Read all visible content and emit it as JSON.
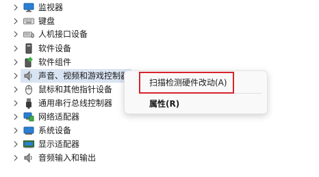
{
  "device_tree": {
    "items": [
      {
        "label": "监视器",
        "icon": "monitor-icon"
      },
      {
        "label": "键盘",
        "icon": "keyboard-icon"
      },
      {
        "label": "人机接口设备",
        "icon": "hid-icon"
      },
      {
        "label": "软件设备",
        "icon": "software-device-icon"
      },
      {
        "label": "软件组件",
        "icon": "software-component-icon"
      },
      {
        "label": "声音、视频和游戏控制器",
        "icon": "speaker-icon",
        "selected": true
      },
      {
        "label": "鼠标和其他指针设备",
        "icon": "mouse-icon"
      },
      {
        "label": "通用串行总线控制器",
        "icon": "usb-icon"
      },
      {
        "label": "网络适配器",
        "icon": "network-adapter-icon"
      },
      {
        "label": "系统设备",
        "icon": "system-device-icon"
      },
      {
        "label": "显示适配器",
        "icon": "display-adapter-icon"
      },
      {
        "label": "音频输入和输出",
        "icon": "audio-io-icon"
      }
    ]
  },
  "context_menu": {
    "scan_label": "扫描检测硬件改动(A)",
    "properties_label": "属性(R)"
  },
  "colors": {
    "selection": "#d9e4f3",
    "highlight_border": "#d8222a"
  }
}
